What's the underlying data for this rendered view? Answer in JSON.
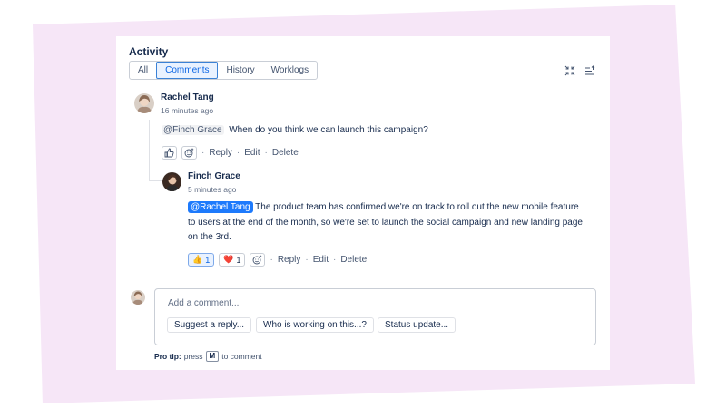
{
  "activity": {
    "title": "Activity",
    "tabs": [
      {
        "label": "All",
        "active": false
      },
      {
        "label": "Comments",
        "active": true
      },
      {
        "label": "History",
        "active": false
      },
      {
        "label": "Worklogs",
        "active": false
      }
    ],
    "toolbar_icons": [
      "collapse-icon",
      "sort-icon"
    ]
  },
  "comments": [
    {
      "author": "Rachel Tang",
      "time": "16 minutes ago",
      "mention": "@Finch Grace",
      "text": "When do you think we can launch this campaign?",
      "actions": {
        "reply": "Reply",
        "edit": "Edit",
        "delete": "Delete"
      },
      "reply": {
        "author": "Finch Grace",
        "time": "5 minutes ago",
        "mention": "@Rachel Tang",
        "text_line1": "The product team has confirmed we're on track to roll out the new mobile feature",
        "text_line2": "to users at the end of the month, so we're set to launch the social campaign and new landing page",
        "text_line3": "on the 3rd.",
        "reactions": [
          {
            "emoji": "👍",
            "count": "1",
            "selected": true
          },
          {
            "emoji": "❤️",
            "count": "1",
            "selected": false
          }
        ],
        "actions": {
          "reply": "Reply",
          "edit": "Edit",
          "delete": "Delete"
        }
      }
    }
  ],
  "composer": {
    "placeholder": "Add a comment...",
    "suggestions": [
      "Suggest a reply...",
      "Who is working on this...?",
      "Status update..."
    ],
    "pro_tip_label": "Pro tip:",
    "pro_tip_press": "press",
    "pro_tip_key": "M",
    "pro_tip_suffix": "to comment"
  },
  "colors": {
    "background_shape": "#f6e6f7",
    "accent": "#0c66e4",
    "mention_blue": "#1d7afc"
  }
}
